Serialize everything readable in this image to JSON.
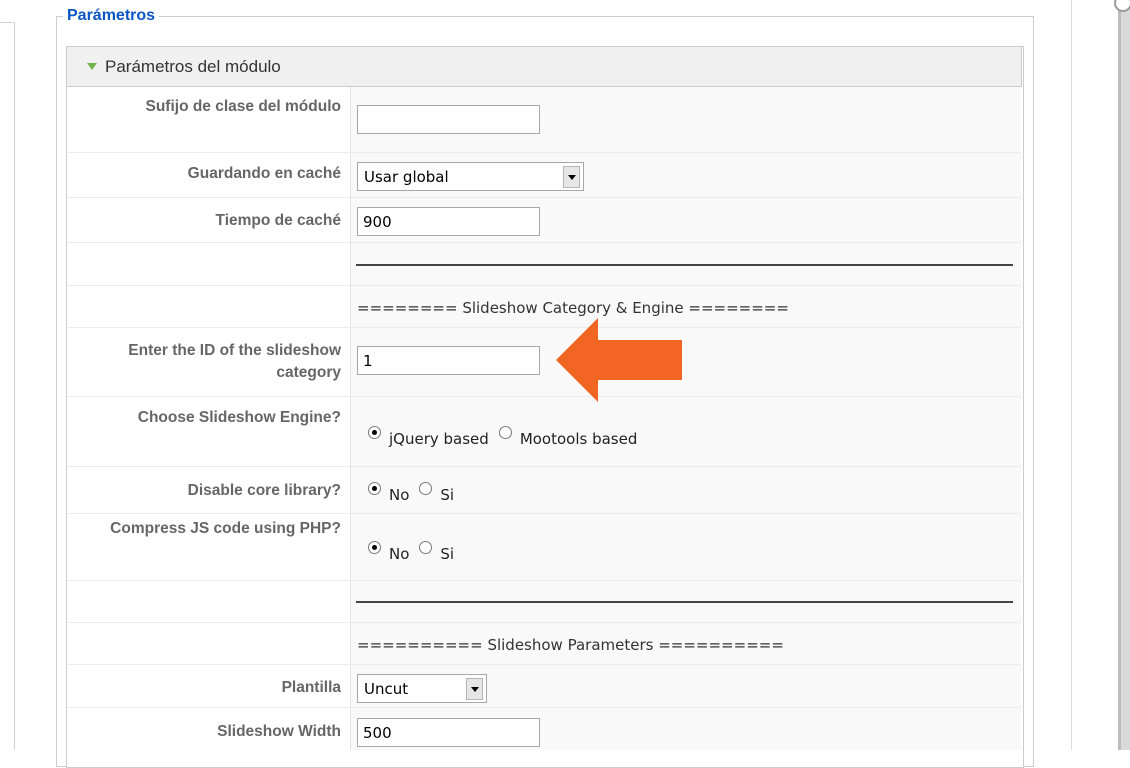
{
  "fieldset": {
    "legend": "Parámetros"
  },
  "panel": {
    "title": "Parámetros del módulo"
  },
  "rows": {
    "suffix": {
      "label": "Sufijo de clase del módulo",
      "value": ""
    },
    "cache": {
      "label": "Guardando en caché",
      "value": "Usar global"
    },
    "cache_time": {
      "label": "Tiempo de caché",
      "value": "900"
    },
    "sep1": {
      "text": "======== Slideshow Category & Engine ========"
    },
    "category_id": {
      "label": "Enter the ID of the slideshow category",
      "value": "1"
    },
    "engine": {
      "label": "Choose Slideshow Engine?",
      "options": [
        "jQuery based",
        "Mootools based"
      ],
      "selected": "jQuery based"
    },
    "disable_core": {
      "label": "Disable core library?",
      "options": [
        "No",
        "Si"
      ],
      "selected": "No"
    },
    "compress": {
      "label": "Compress JS code using PHP?",
      "options": [
        "No",
        "Si"
      ],
      "selected": "No"
    },
    "sep2": {
      "text": "========== Slideshow Parameters =========="
    },
    "template": {
      "label": "Plantilla",
      "value": "Uncut"
    },
    "width": {
      "label": "Slideshow Width",
      "value": "500"
    }
  },
  "colors": {
    "legend": "#0b55c4",
    "arrow": "#f26522",
    "triangle": "#71b44b"
  },
  "icons": {
    "collapse": "triangle-down-icon",
    "pointer": "arrow-left-icon"
  }
}
